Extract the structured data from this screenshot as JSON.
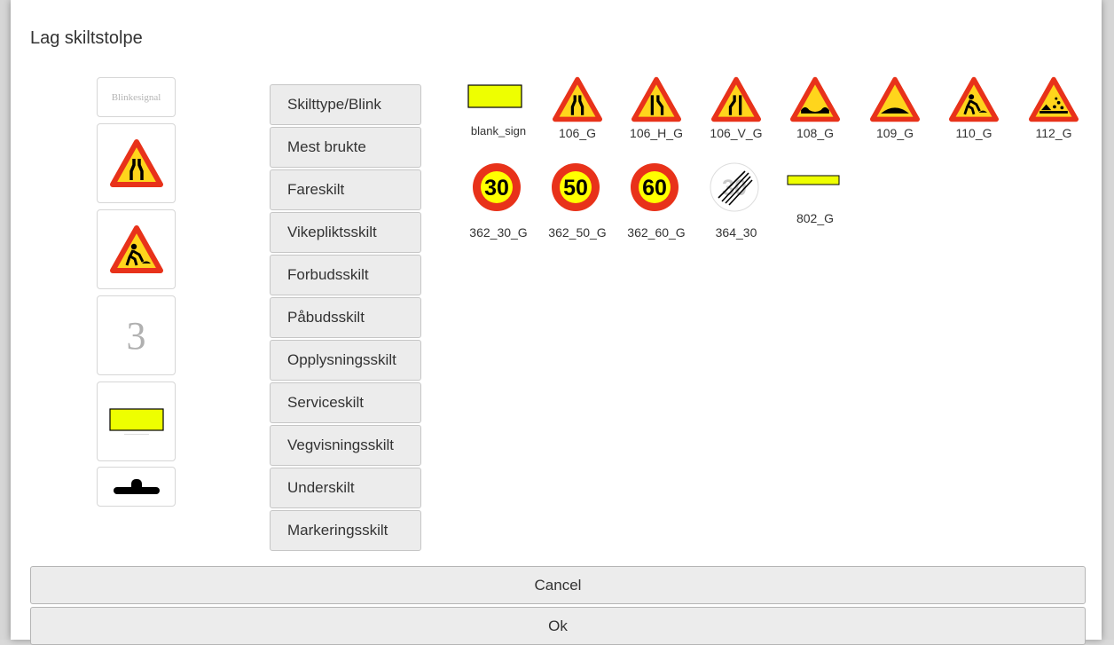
{
  "dialog": {
    "title": "Lag skiltstolpe"
  },
  "post": {
    "tiles": [
      {
        "kind": "text-sign",
        "text": "Blinkesignal"
      },
      {
        "kind": "icon",
        "icon": "road-narrows-both-icon"
      },
      {
        "kind": "icon",
        "icon": "road-works-icon"
      },
      {
        "kind": "number",
        "text": "3"
      },
      {
        "kind": "icon",
        "icon": "blank-sign-icon"
      },
      {
        "kind": "icon",
        "icon": "post-foot-icon"
      }
    ]
  },
  "categories": [
    "Skilttype/Blink",
    "Mest brukte",
    "Fareskilt",
    "Vikepliktsskilt",
    "Forbudsskilt",
    "Påbudsskilt",
    "Opplysningsskilt",
    "Serviceskilt",
    "Vegvisningsskilt",
    "Underskilt",
    "Markeringsskilt"
  ],
  "signs": [
    {
      "label": "blank_sign",
      "icon": "blank-sign-icon"
    },
    {
      "label": "106_G",
      "icon": "road-narrows-both-icon"
    },
    {
      "label": "106_H_G",
      "icon": "road-narrows-right-icon"
    },
    {
      "label": "106_V_G",
      "icon": "road-narrows-left-icon"
    },
    {
      "label": "108_G",
      "icon": "uneven-road-icon"
    },
    {
      "label": "109_G",
      "icon": "speed-bump-icon"
    },
    {
      "label": "110_G",
      "icon": "road-works-icon"
    },
    {
      "label": "112_G",
      "icon": "loose-gravel-icon"
    },
    {
      "label": "362_30_G",
      "icon": "speed-limit-icon",
      "value": "30"
    },
    {
      "label": "362_50_G",
      "icon": "speed-limit-icon",
      "value": "50"
    },
    {
      "label": "362_60_G",
      "icon": "speed-limit-icon",
      "value": "60"
    },
    {
      "label": "364_30",
      "icon": "end-speed-limit-icon",
      "value": "30"
    },
    {
      "label": "802_G",
      "icon": "marker-bar-icon"
    }
  ],
  "buttons": {
    "cancel": "Cancel",
    "ok": "Ok"
  },
  "colors": {
    "warning_red": "#e8321a",
    "warning_fill": "#ffd51c",
    "speed_fill": "#ffff00",
    "blank_sign_fill": "#eeff00"
  }
}
